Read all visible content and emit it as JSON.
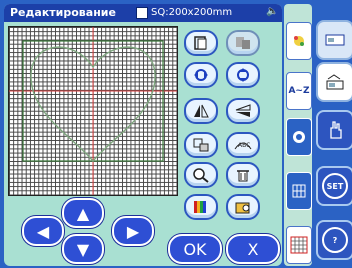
{
  "header": {
    "title": "Редактирование",
    "size_label": "SQ:200x200mm"
  },
  "buttons": {
    "ok_label": "OK",
    "cancel_label": "X"
  },
  "side_tabs": {
    "text_tab_label": "A~Z"
  },
  "panel": {
    "set_label": "SET",
    "help_label": "?"
  },
  "colors": {
    "frame": "#2b62c4",
    "panel_bg": "#a9e0d2",
    "title_bar": "#1c3fa8",
    "button_blue": "#2e4fd4"
  }
}
